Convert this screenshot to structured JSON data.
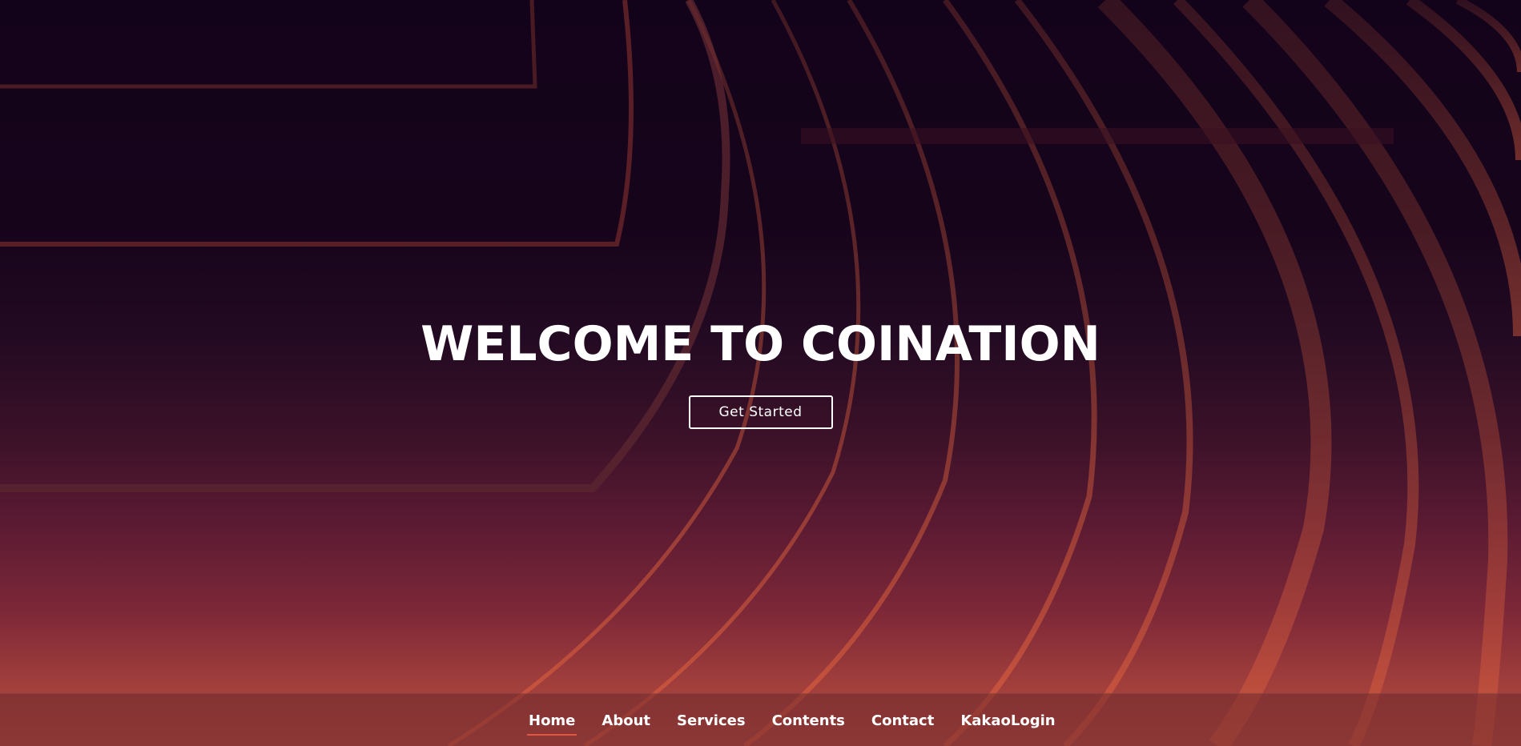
{
  "hero": {
    "title": "WELCOME TO COINATION",
    "cta_label": "Get Started"
  },
  "nav": {
    "items": [
      {
        "label": "Home",
        "active": true
      },
      {
        "label": "About",
        "active": false
      },
      {
        "label": "Services",
        "active": false
      },
      {
        "label": "Contents",
        "active": false
      },
      {
        "label": "Contact",
        "active": false
      },
      {
        "label": "KakaoLogin",
        "active": false
      }
    ]
  },
  "colors": {
    "accent": "#e8553f",
    "background_top": "#13031a",
    "background_bottom": "#b04a3e",
    "text": "#ffffff"
  }
}
